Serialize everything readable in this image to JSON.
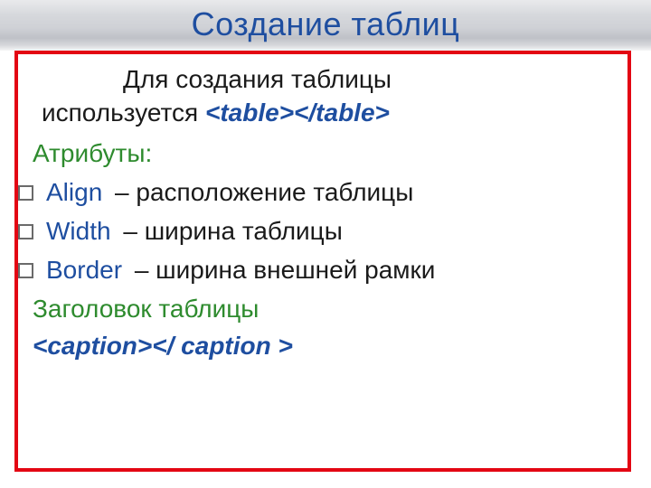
{
  "title": "Создание таблиц",
  "intro": {
    "line1": "Для создания таблицы",
    "line2_prefix": "используется ",
    "tag": "<table></table>"
  },
  "attributes_label": "Атрибуты:",
  "attrs": [
    {
      "name": "Align",
      "desc": "– расположение таблицы"
    },
    {
      "name": "Width",
      "desc": "– ширина таблицы"
    },
    {
      "name": "Border",
      "desc": "– ширина внешней рамки"
    }
  ],
  "caption_label": "Заголовок таблицы",
  "caption_tag": "<caption></ caption >"
}
